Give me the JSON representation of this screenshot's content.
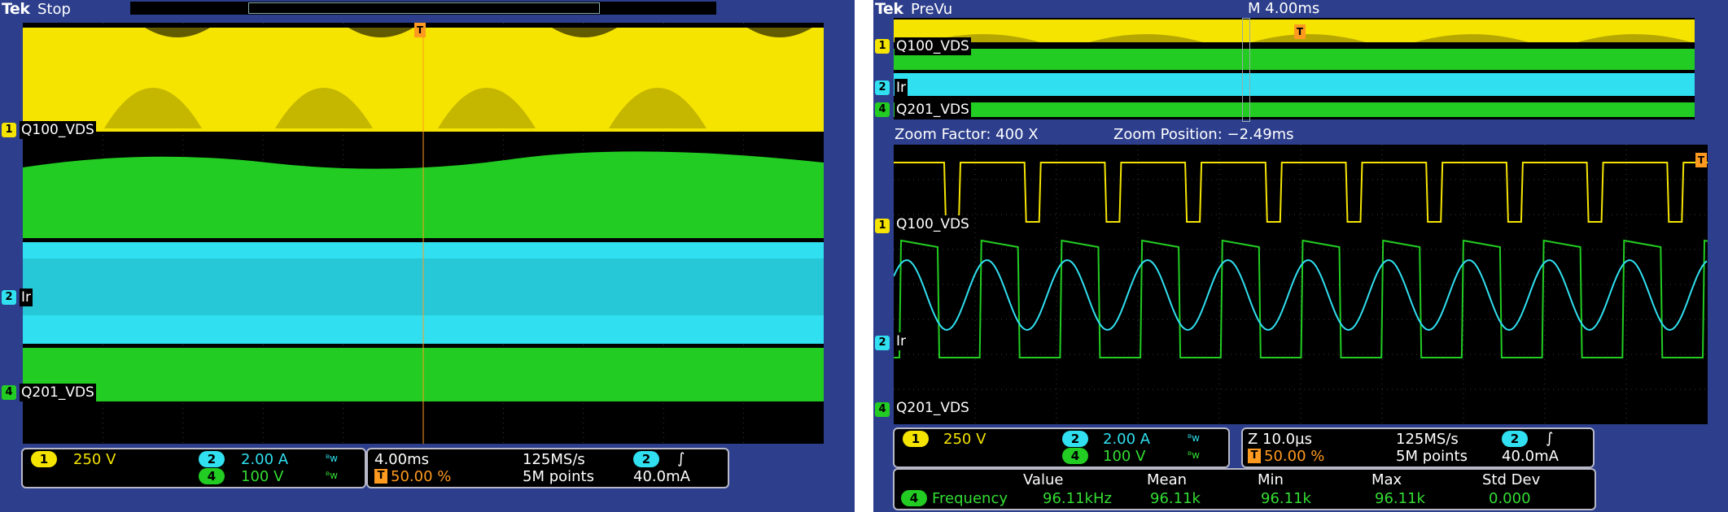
{
  "left": {
    "brand": "Tek",
    "state": "Stop",
    "channels": {
      "ch1_label": "Q100_VDS",
      "ch2_label": "Ir",
      "ch4_label": "Q201_VDS"
    },
    "readout": {
      "ch1_marker": "1",
      "ch1_scale": "250 V",
      "ch2_marker": "2",
      "ch2_scale": "2.00 A",
      "ch4_marker": "4",
      "ch4_scale": "100 V",
      "bw_symbol": "ᴮw",
      "timebase": "4.00ms",
      "trigger_pos": "50.00 %",
      "sample_rate": "125MS/s",
      "record_length": "5M points",
      "trigger_source": "2",
      "trigger_slope": "∫",
      "trigger_level": "40.0mA"
    }
  },
  "right": {
    "brand": "Tek",
    "state": "PreVu",
    "main_timebase": "M 4.00ms",
    "overview_labels": {
      "ch1": "Q100_VDS",
      "ch2": "Ir",
      "ch4": "Q201_VDS"
    },
    "zoom_factor": "Zoom Factor: 400 X",
    "zoom_position": "Zoom Position: −2.49ms",
    "channels": {
      "ch1_label": "Q100_VDS",
      "ch2_label": "Ir",
      "ch4_label": "Q201_VDS"
    },
    "readout": {
      "ch1_marker": "1",
      "ch1_scale": "250 V",
      "ch2_marker": "2",
      "ch2_scale": "2.00 A",
      "ch4_marker": "4",
      "ch4_scale": "100 V",
      "bw_symbol": "ᴮw",
      "zoom_timebase": "Z 10.0µs",
      "trigger_pos": "50.00 %",
      "sample_rate": "125MS/s",
      "record_length": "5M points",
      "trigger_source": "2",
      "trigger_slope": "∫",
      "trigger_level": "40.0mA"
    },
    "measurement": {
      "headers": [
        "Value",
        "Mean",
        "Min",
        "Max",
        "Std Dev"
      ],
      "channel": "4",
      "name": "Frequency",
      "values": [
        "96.11kHz",
        "96.11k",
        "96.11k",
        "96.11k",
        "0.000"
      ]
    }
  },
  "colors": {
    "ch1": "#f5e400",
    "ch2": "#30e0f0",
    "ch4": "#22cc22",
    "trigger": "#ff9a20",
    "bezel": "#2d3f8c"
  }
}
